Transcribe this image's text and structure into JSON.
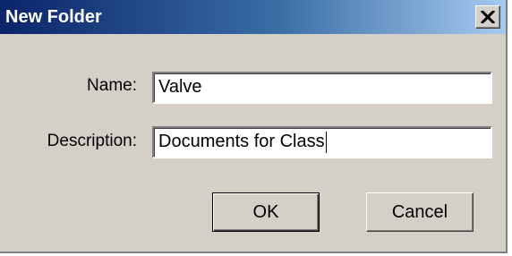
{
  "dialog": {
    "title": "New Folder",
    "close_icon": "close-x-icon"
  },
  "form": {
    "name_label": "Name:",
    "name_value": "Valve",
    "description_label": "Description:",
    "description_value": "Documents for Class"
  },
  "buttons": {
    "ok_label": "OK",
    "cancel_label": "Cancel"
  },
  "colors": {
    "titlebar_start": "#0a246a",
    "titlebar_end": "#a6caf0",
    "dialog_face": "#d4d0c8"
  }
}
